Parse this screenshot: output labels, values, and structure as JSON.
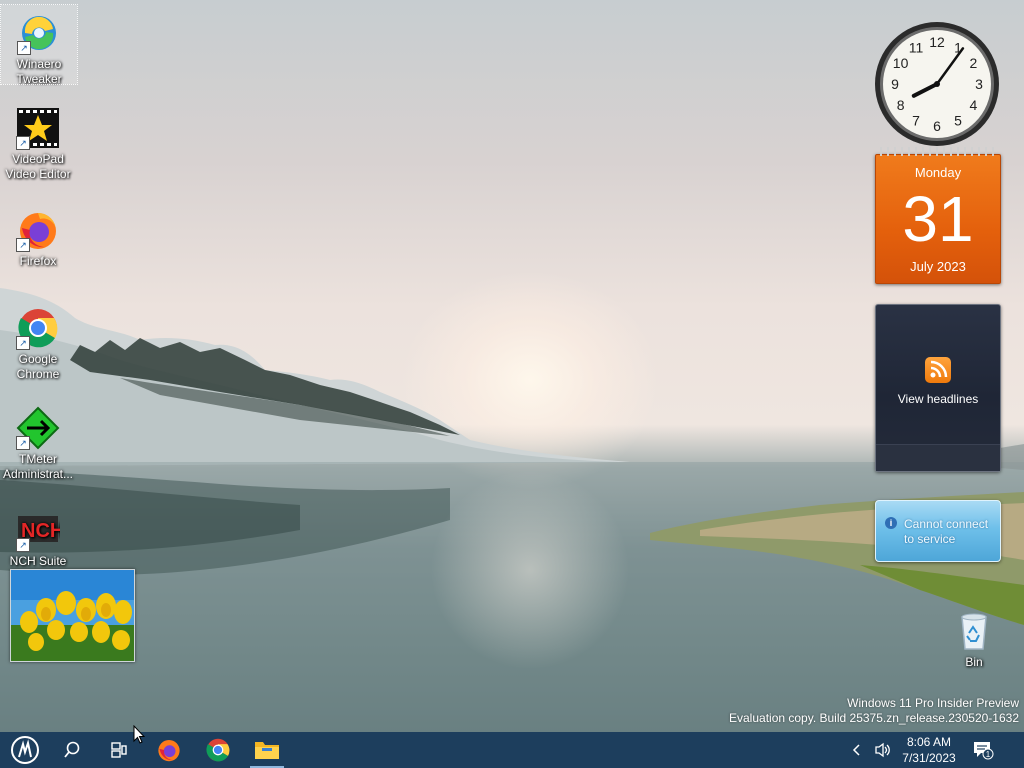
{
  "desktop": {
    "icons": [
      {
        "label_line1": "Winaero",
        "label_line2": "Tweaker",
        "icon": "winaero-tweaker-icon"
      },
      {
        "label_line1": "VideoPad",
        "label_line2": "Video Editor",
        "icon": "videopad-icon"
      },
      {
        "label_line1": "Firefox",
        "label_line2": "",
        "icon": "firefox-icon"
      },
      {
        "label_line1": "Google",
        "label_line2": "Chrome",
        "icon": "chrome-icon"
      },
      {
        "label_line1": "TMeter",
        "label_line2": "Administrat...",
        "icon": "tmeter-icon"
      },
      {
        "label_line1": "NCH Suite",
        "label_line2": "",
        "icon": "nch-suite-icon"
      },
      {
        "label_line1": "Bin",
        "label_line2": "",
        "icon": "recycle-bin-icon"
      }
    ],
    "watermark": {
      "line1": "Windows 11 Pro Insider Preview",
      "line2": "Evaluation copy. Build 25375.zn_release.230520-1632"
    }
  },
  "gadgets": {
    "clock": {
      "hour": 8,
      "minute": 6,
      "numerals": [
        "12",
        "1",
        "2",
        "3",
        "4",
        "5",
        "6",
        "7",
        "8",
        "9",
        "10",
        "11"
      ]
    },
    "calendar": {
      "day_name": "Monday",
      "day": "31",
      "month_year": "July 2023"
    },
    "feed": {
      "label": "View headlines"
    },
    "weather": {
      "message_line1": "Cannot connect",
      "message_line2": "to service"
    }
  },
  "taskbar": {
    "start_icon": "start-logo-icon",
    "search_icon": "search-icon",
    "task_view_icon": "task-view-icon",
    "pinned": [
      {
        "name": "firefox",
        "icon": "firefox-icon",
        "running": false
      },
      {
        "name": "chrome",
        "icon": "chrome-icon",
        "running": false
      },
      {
        "name": "file-explorer",
        "icon": "folder-icon",
        "running": true
      }
    ],
    "tray": {
      "time": "8:06 AM",
      "date": "7/31/2023",
      "notification_count": "1"
    }
  },
  "colors": {
    "taskbar": "#1d3e5d",
    "calendar_orange": "#e4600c",
    "feed_dark": "#1f2636",
    "weather_blue": "#6fc0ea"
  }
}
